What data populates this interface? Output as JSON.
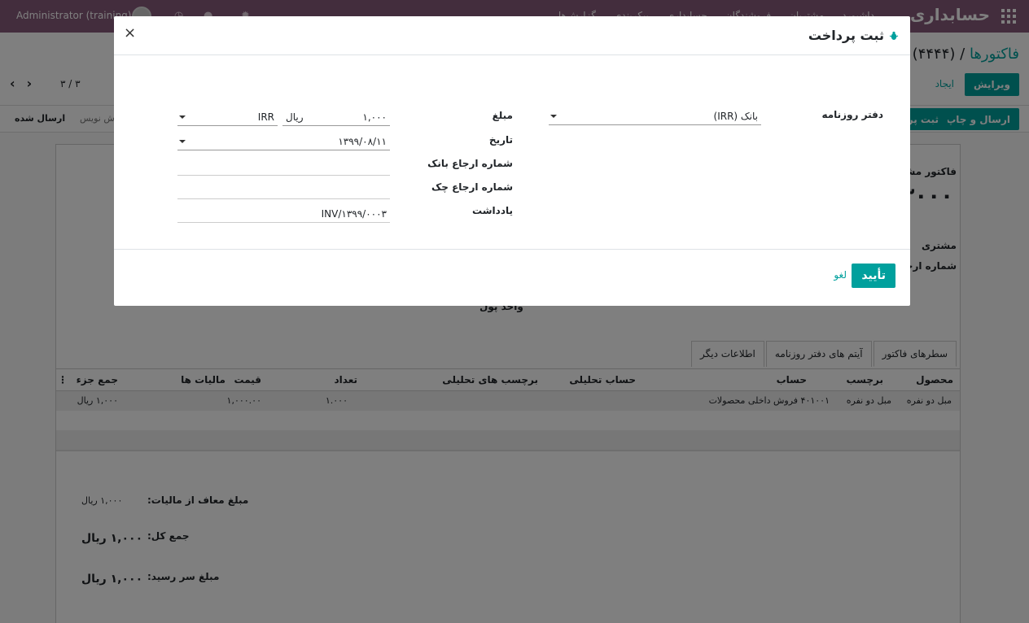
{
  "navbar": {
    "brand": "حسابداری",
    "menus": [
      "داشبورد",
      "مشتریان",
      "فروشندگان",
      "حسابداری",
      "پیکربندی",
      "گزارش‌ها",
      "چک‌ها"
    ],
    "user": "Administrator (training)"
  },
  "control_panel": {
    "breadcrumb_link": "فاکتورها",
    "breadcrumb_sep": "/",
    "breadcrumb_current": "(۴۴۴۴)",
    "edit_label": "ویرایش",
    "create_label": "ایجاد",
    "pager": "۳ / ۳"
  },
  "statusbar": {
    "send_print_label": "ارسال و چاپ",
    "register_payment_label": "ثبت پر",
    "status_sent": "ارسال شده",
    "status_draft": "ش نویس"
  },
  "sheet": {
    "invoice_type": "فاکتور مشت",
    "invoice_number": "۳۰۰۰/",
    "customer_label": "مشتری",
    "ref_label": "شماره ارجاع",
    "currency_label": "واحد پول",
    "tabs": [
      "سطرهای فاکتور",
      "آیتم های دفتر روزنامه",
      "اطلاعات دیگر"
    ],
    "columns": {
      "product": "محصول",
      "label": "برچسب",
      "account": "حساب",
      "analytic_account": "حساب تحلیلی",
      "analytic_tags": "برچسب های تحلیلی",
      "quantity": "تعداد",
      "price": "قیمت",
      "taxes": "مالیات ها",
      "subtotal": "جمع جزء"
    },
    "row": {
      "product": "مبل دو نفره",
      "label": "مبل دو نفره",
      "account": "۴۰۱۰۰۱ فروش داخلی محصولات",
      "quantity": "۱.۰۰۰",
      "price": "۱,۰۰۰.۰۰",
      "subtotal": "۱,۰۰۰ ریال"
    },
    "totals": {
      "untaxed_label": "مبلغ معاف از مالیات:",
      "untaxed_value": "۱,۰۰۰ ریال",
      "total_label": "جمع کل:",
      "total_value": "۱,۰۰۰ ریال",
      "due_label": "مبلغ سر رسید:",
      "due_value": "۱,۰۰۰ ریال"
    }
  },
  "modal": {
    "title": "ثبت پرداخت",
    "journal_label": "دفتر روزنامه",
    "journal_value": "بانک (IRR)",
    "amount_label": "مبلغ",
    "amount_value": "۱,۰۰۰",
    "currency_symbol": "ریال",
    "currency_value": "IRR",
    "date_label": "تاریخ",
    "date_value": "۱۳۹۹/۰۸/۱۱",
    "bank_ref_label": "شماره ارجاع بانک",
    "bank_ref_value": "",
    "check_ref_label": "شماره ارجاع چک",
    "check_ref_value": "",
    "memo_label": "یادداشت",
    "memo_value": "INV/۱۳۹۹/۰۰۰۳",
    "confirm_label": "تأیید",
    "cancel_label": "لغو",
    "close_glyph": "×"
  },
  "colors": {
    "primary": "#00a09d",
    "navbar": "#875a7b"
  }
}
